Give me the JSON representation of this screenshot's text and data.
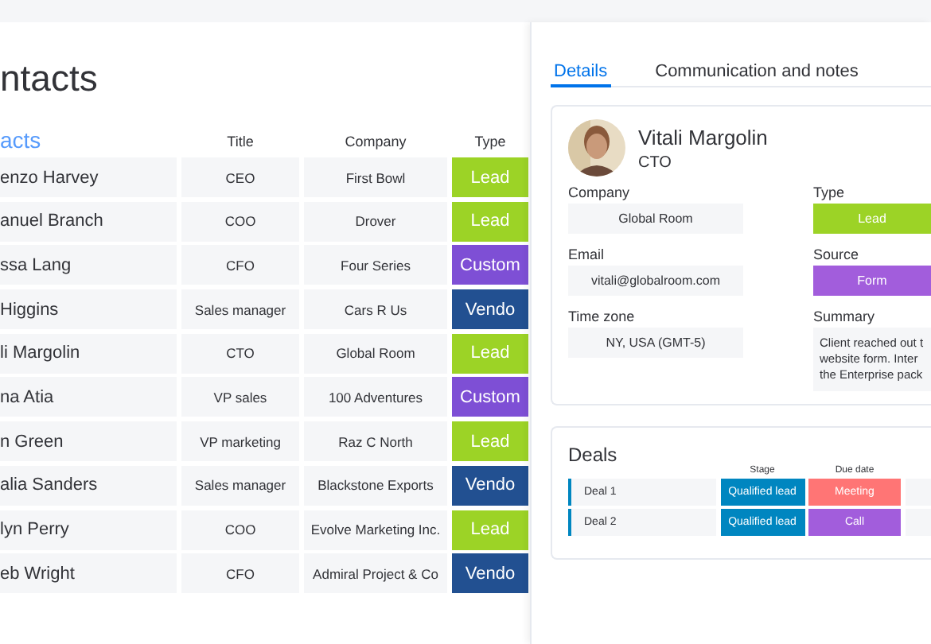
{
  "page": {
    "title": "ntacts"
  },
  "group": {
    "label": "acts"
  },
  "table": {
    "columns": [
      "Title",
      "Company",
      "Type"
    ],
    "rows": [
      {
        "name": "enzo Harvey",
        "title": "CEO",
        "company": "First Bowl",
        "type": "Lead",
        "color": "#9cd326"
      },
      {
        "name": "anuel Branch",
        "title": "COO",
        "company": "Drover",
        "type": "Lead",
        "color": "#9cd326"
      },
      {
        "name": "ssa Lang",
        "title": "CFO",
        "company": "Four Series",
        "type": "Custom",
        "color": "#7e4fd5"
      },
      {
        "name": "Higgins",
        "title": "Sales manager",
        "company": "Cars R Us",
        "type": "Vendo",
        "color": "#225091"
      },
      {
        "name": "li Margolin",
        "title": "CTO",
        "company": "Global Room",
        "type": "Lead",
        "color": "#9cd326"
      },
      {
        "name": "na Atia",
        "title": "VP sales",
        "company": "100 Adventures",
        "type": "Custom",
        "color": "#7e4fd5"
      },
      {
        "name": "n Green",
        "title": "VP marketing",
        "company": "Raz C North",
        "type": "Lead",
        "color": "#9cd326"
      },
      {
        "name": "alia Sanders",
        "title": "Sales manager",
        "company": "Blackstone Exports",
        "type": "Vendo",
        "color": "#225091"
      },
      {
        "name": "lyn Perry",
        "title": "COO",
        "company": "Evolve Marketing Inc.",
        "type": "Lead",
        "color": "#9cd326"
      },
      {
        "name": "eb Wright",
        "title": "CFO",
        "company": "Admiral Project & Co",
        "type": "Vendo",
        "color": "#225091"
      }
    ]
  },
  "tabs": [
    {
      "label": "Details",
      "selected": true
    },
    {
      "label": "Communication and notes",
      "selected": false
    }
  ],
  "contact": {
    "name": "Vitali Margolin",
    "role": "CTO",
    "fields": [
      {
        "label": "Company",
        "value": "Global Room",
        "kind": "text"
      },
      {
        "label": "Type",
        "value": "Lead",
        "kind": "tag",
        "color": "#9cd326"
      },
      {
        "label": "Email",
        "value": "vitali@globalroom.com",
        "kind": "text"
      },
      {
        "label": "Source",
        "value": "Form",
        "kind": "tag",
        "color": "#a25ddc"
      },
      {
        "label": "Time zone",
        "value": "NY, USA (GMT-5)",
        "kind": "text"
      },
      {
        "label": "Summary",
        "lines": [
          "Client reached out t",
          "website form. Inter",
          "the Enterprise pack"
        ],
        "kind": "note"
      }
    ]
  },
  "deals": {
    "title": "Deals",
    "columns": [
      "Stage",
      "Due date"
    ],
    "rows": [
      {
        "name": "Deal 1",
        "stage": {
          "label": "Qualified lead",
          "color": "#0086c0"
        },
        "due": {
          "label": "Meeting",
          "color": "#ff7575"
        }
      },
      {
        "name": "Deal 2",
        "stage": {
          "label": "Qualified lead",
          "color": "#0086c0"
        },
        "due": {
          "label": "Call",
          "color": "#a25ddc"
        }
      }
    ]
  }
}
